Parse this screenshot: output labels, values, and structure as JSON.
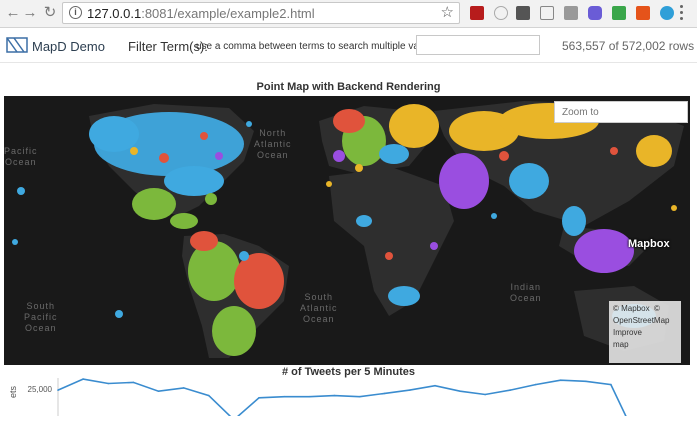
{
  "browser": {
    "url_host": "127.0.0.1",
    "url_path": ":8081/example/example2.html"
  },
  "topbar": {
    "brand": "MapD Demo",
    "filter_label": "Filter Term(s):",
    "filter_hint": "use a comma between terms to search multiple values",
    "filter_value": "",
    "row_count": "563,557 of 572,002 rows"
  },
  "map": {
    "title": "Point Map with Backend Rendering",
    "zoom_placeholder": "Zoom to",
    "oceans": {
      "north_pacific": "Pacific\nOcean",
      "north_atlantic": "North\nAtlantic\nOcean",
      "south_pacific": "South\nPacific\nOcean",
      "south_atlantic": "South\nAtlantic\nOcean",
      "indian": "Indian\nOcean"
    },
    "attribution": [
      "© Mapbox",
      "©",
      "OpenStreetMap",
      "Improve",
      "map"
    ],
    "logo": "Mapbox",
    "colors": {
      "blue": "#3fa9e0",
      "green": "#7cb83c",
      "red": "#e0533c",
      "yellow": "#e9b528",
      "purple": "#9a4ee0"
    }
  },
  "chart": {
    "title": "# of Tweets per 5 Minutes",
    "ylabel": "ets"
  },
  "chart_data": {
    "type": "line",
    "title": "# of Tweets per 5 Minutes",
    "ylabel": "ets",
    "ytick_labels": [
      "25,000"
    ],
    "ylim": [
      0,
      30000
    ],
    "x": [
      0,
      1,
      2,
      3,
      4,
      5,
      6,
      7,
      8,
      9,
      10,
      11,
      12,
      13,
      14,
      15,
      16,
      17,
      18,
      19,
      20,
      21,
      22,
      23
    ],
    "values": [
      24500,
      29500,
      27500,
      28000,
      24000,
      25500,
      22000,
      11000,
      21000,
      21500,
      21500,
      22000,
      21500,
      23000,
      24500,
      26500,
      24000,
      22500,
      24500,
      27000,
      29000,
      28500,
      27000,
      3000
    ]
  }
}
